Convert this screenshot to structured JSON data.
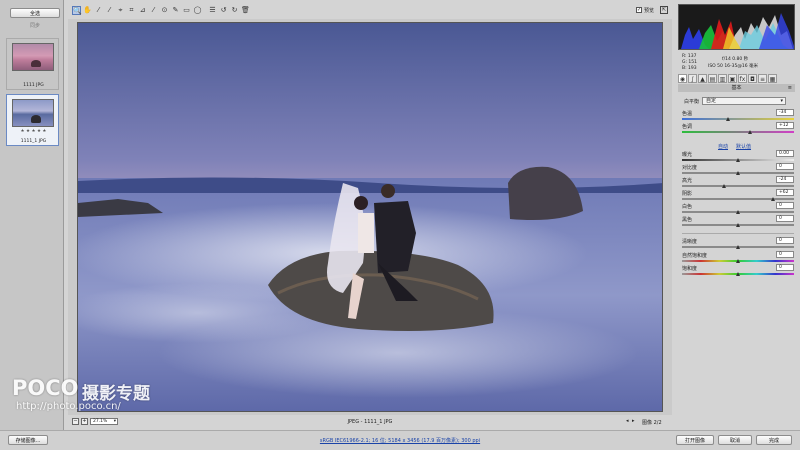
{
  "filmstrip": {
    "select_all": "全选",
    "sync": "同步",
    "thumbs": [
      {
        "name": "1111 JPG",
        "rating": ""
      },
      {
        "name": "1111_1 JPG",
        "rating": "★ ★ ★ ★ ★"
      }
    ]
  },
  "toolbar": {
    "tools": [
      "zoom-icon",
      "hand-icon",
      "white-balance-icon",
      "color-sampler-icon",
      "target-adjust-icon",
      "crop-icon",
      "straighten-icon",
      "spot-removal-icon",
      "red-eye-icon",
      "adjustment-brush-icon",
      "graduated-filter-icon",
      "radial-filter-icon",
      "preferences-icon",
      "rotate-ccw-icon",
      "rotate-cw-icon",
      "trash-icon"
    ],
    "tool_glyphs": [
      "🔍",
      "✋",
      "⁄",
      "⁄",
      "⌖",
      "⌗",
      "⊿",
      "⁄",
      "⊙",
      "✎",
      "▭",
      "◯",
      "☰",
      "↺",
      "↻",
      "🗑"
    ],
    "preview_label": "预览",
    "preview_checked": true
  },
  "status": {
    "zoom": "27.1%",
    "filename": "JPEG - 1111_1 JPG",
    "image_counter": "图像 2/2"
  },
  "readout": {
    "r": "R:  137",
    "g": "G:  151",
    "b": "B:  193",
    "aperture_shutter": "f/14   0.80 秒",
    "iso_lens": "ISO 50   16-35@16 毫米"
  },
  "panel": {
    "title": "基本",
    "wb_label": "白平衡",
    "wb_value": "自定",
    "temperature_label": "色温",
    "temperature_value": "-34",
    "tint_label": "色调",
    "tint_value": "+12",
    "auto": "自动",
    "default": "默认值",
    "exposure_label": "曝光",
    "exposure_value": "0.00",
    "contrast_label": "对比度",
    "contrast_value": "0",
    "highlights_label": "高光",
    "highlights_value": "-24",
    "shadows_label": "阴影",
    "shadows_value": "+62",
    "whites_label": "白色",
    "whites_value": "0",
    "blacks_label": "黑色",
    "blacks_value": "0",
    "clarity_label": "清晰度",
    "clarity_value": "0",
    "vibrance_label": "自然饱和度",
    "vibrance_value": "0",
    "saturation_label": "饱和度",
    "saturation_value": "0"
  },
  "bottom": {
    "save_image": "存储图像...",
    "workflow_link": "sRGB IEC61966-2.1; 16 位; 5184 x 3456 (17.9 百万像素); 300 ppi",
    "open_image": "打开图像",
    "cancel": "取消",
    "done": "完成"
  },
  "watermark": {
    "logo": "POCO",
    "title": "摄影专题",
    "url": "http://photo.poco.cn/"
  }
}
